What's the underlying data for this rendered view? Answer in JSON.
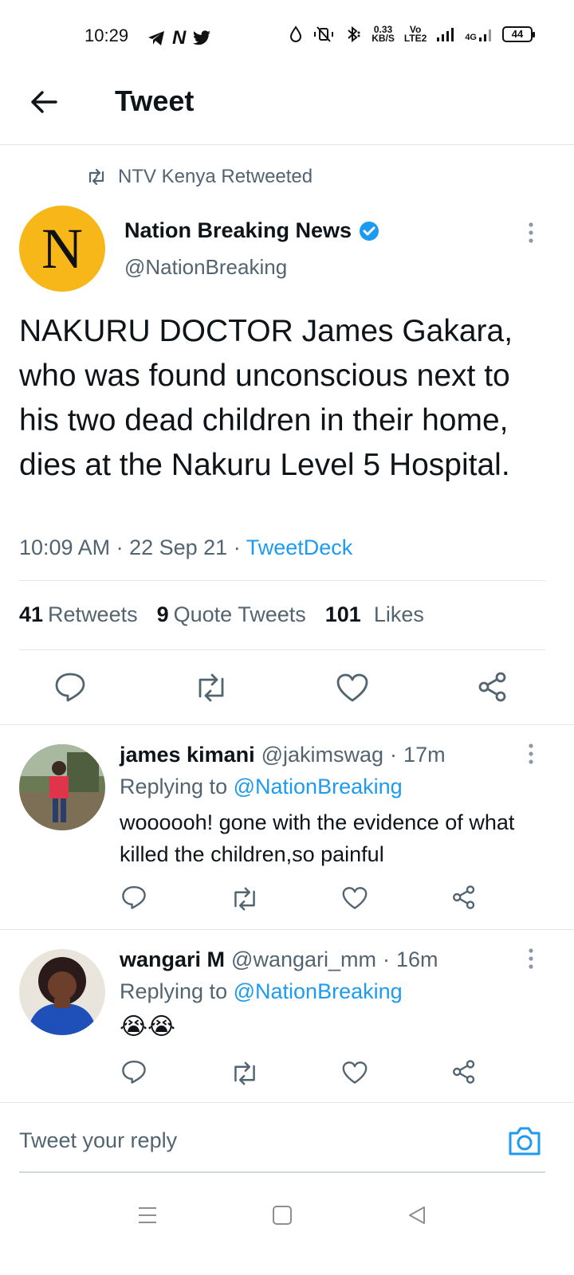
{
  "status_bar": {
    "time": "10:29",
    "net_speed_value": "0.33",
    "net_speed_unit": "KB/S",
    "volte_top": "Vo",
    "volte_bottom": "LTE2",
    "network_type": "4G",
    "battery": "44"
  },
  "header": {
    "title": "Tweet"
  },
  "tweet": {
    "retweet_context": "NTV Kenya Retweeted",
    "avatar_letter": "N",
    "author_name": "Nation Breaking News",
    "author_handle": "@NationBreaking",
    "text": "NAKURU DOCTOR James Gakara, who was found unconscious next to his two dead children in their home, dies at the Nakuru Level 5 Hospital.",
    "time": "10:09 AM",
    "date": "22 Sep 21",
    "source": "TweetDeck",
    "retweets_count": "41",
    "retweets_label": "Retweets",
    "quotes_count": "9",
    "quotes_label": "Quote Tweets",
    "likes_count": "101",
    "likes_label": "Likes"
  },
  "replies": [
    {
      "name": "james kimani",
      "handle": "@jakimswag",
      "age": "17m",
      "replying_prefix": "Replying to",
      "replying_to": "@NationBreaking",
      "text": "woooooh! gone with the evidence of what killed the children,so painful"
    },
    {
      "name": "wangari M",
      "handle": "@wangari_mm",
      "age": "16m",
      "replying_prefix": "Replying to",
      "replying_to": "@NationBreaking",
      "text": "😭😭"
    }
  ],
  "composer": {
    "placeholder": "Tweet your reply"
  },
  "colors": {
    "accent": "#1d9bf0",
    "secondary_text": "#536471",
    "avatar_bg": "#f7b718"
  }
}
